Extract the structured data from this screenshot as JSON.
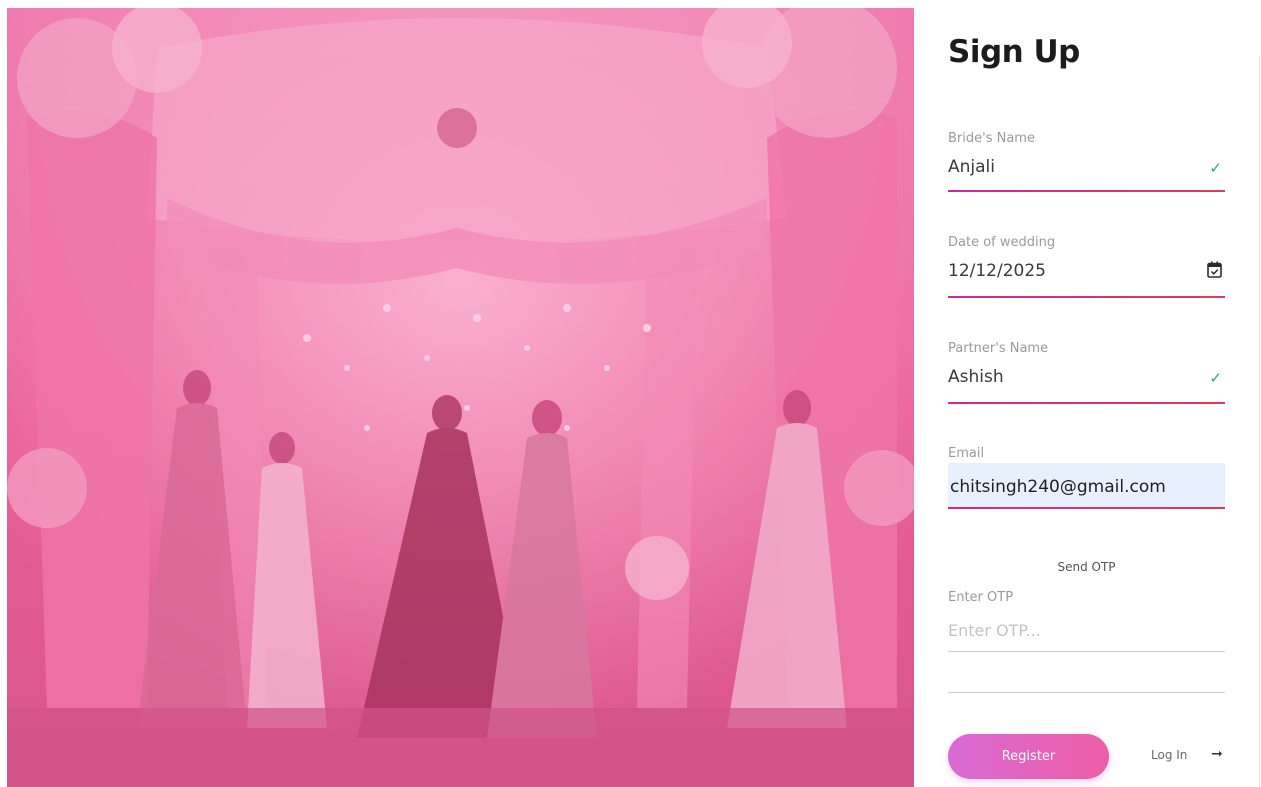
{
  "hero": {
    "image": "wedding-ceremony-photo",
    "tint": "#e9649c"
  },
  "form": {
    "title": "Sign Up",
    "brides_name": {
      "label": "Bride's Name",
      "value": "Anjali"
    },
    "wedding_date": {
      "label": "Date of wedding",
      "value": "12/12/2025"
    },
    "partners_name": {
      "label": "Partner's Name",
      "value": "Ashish"
    },
    "email": {
      "label": "Email",
      "value": "chitsingh240@gmail.com"
    },
    "send_otp": "Send OTP",
    "otp": {
      "label": "Enter OTP",
      "placeholder": "Enter OTP..."
    },
    "register_label": "Register",
    "login_label": "Log In",
    "login_arrow": "➞"
  },
  "icons": {
    "valid": "check-icon",
    "calendar": "calendar-icon",
    "arrow": "arrow-right-icon"
  },
  "colors": {
    "accent": "#c92aa0",
    "valid": "#2eaa5b",
    "button": "#e664c4"
  }
}
